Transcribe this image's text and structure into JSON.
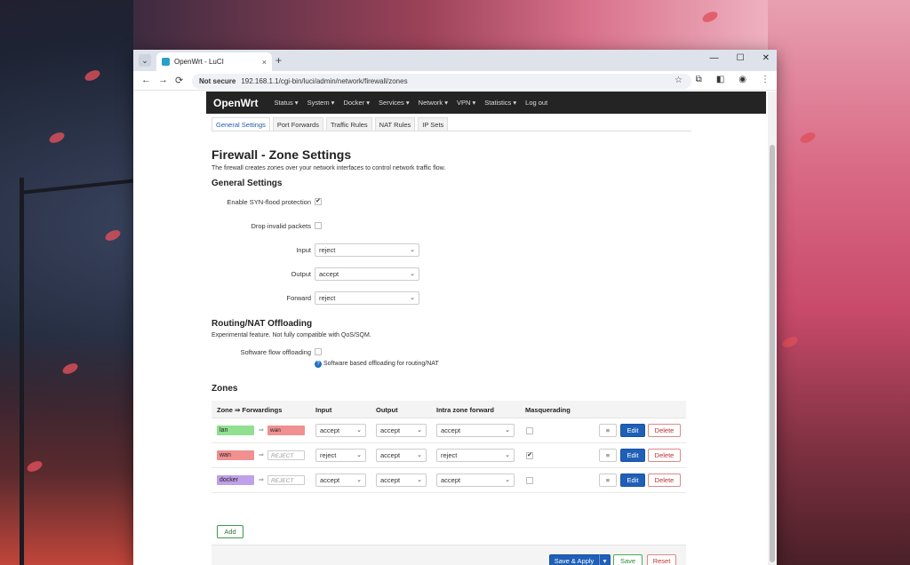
{
  "browser": {
    "tab_title": "OpenWrt - LuCI",
    "tab_close": "×",
    "new_tab": "+",
    "tab_dropdown": "⌄",
    "not_secure": "Not secure",
    "url": "192.168.1.1/cgi-bin/luci/admin/network/firewall/zones",
    "minimize": "—",
    "maximize": "☐",
    "close": "✕",
    "back": "←",
    "forward": "→",
    "reload": "⟳",
    "star": "☆",
    "ext": "⧉",
    "sidepanel": "◧",
    "profile": "◉",
    "menu": "⋮"
  },
  "nav": {
    "brand": "OpenWrt",
    "items": [
      "Status ▾",
      "System ▾",
      "Docker ▾",
      "Services ▾",
      "Network ▾",
      "VPN ▾",
      "Statistics ▾",
      "Log out"
    ]
  },
  "subtabs": [
    "General Settings",
    "Port Forwards",
    "Traffic Rules",
    "NAT Rules",
    "IP Sets"
  ],
  "page": {
    "title": "Firewall - Zone Settings",
    "description": "The firewall creates zones over your network interfaces to control network traffic flow."
  },
  "general": {
    "heading": "General Settings",
    "syn_label": "Enable SYN-flood protection",
    "syn_checked": "✔",
    "drop_label": "Drop invalid packets",
    "input_label": "Input",
    "input_value": "reject",
    "output_label": "Output",
    "output_value": "accept",
    "forward_label": "Forward",
    "forward_value": "reject"
  },
  "offload": {
    "heading": "Routing/NAT Offloading",
    "description": "Experimental feature. Not fully compatible with QoS/SQM.",
    "flow_label": "Software flow offloading",
    "hint": "Software based offloading for routing/NAT"
  },
  "zones": {
    "heading": "Zones",
    "headers": [
      "Zone ⇒ Forwardings",
      "Input",
      "Output",
      "Intra zone forward",
      "Masquerading"
    ],
    "rows": [
      {
        "zone": "lan",
        "zone_color": "#90e090",
        "fwd": "wan",
        "fwd_color": "#f09090",
        "fwd_reject": false,
        "input": "accept",
        "output": "accept",
        "intra": "accept",
        "masq": ""
      },
      {
        "zone": "wan",
        "zone_color": "#f09090",
        "fwd": "REJECT",
        "fwd_color": "#ffffff",
        "fwd_reject": true,
        "input": "reject",
        "output": "accept",
        "intra": "reject",
        "masq": "✔"
      },
      {
        "zone": "docker",
        "zone_color": "#c0a0e8",
        "fwd": "REJECT",
        "fwd_color": "#ffffff",
        "fwd_reject": true,
        "input": "accept",
        "output": "accept",
        "intra": "accept",
        "masq": ""
      }
    ],
    "drag": "≡",
    "edit": "Edit",
    "delete": "Delete",
    "add": "Add"
  },
  "footer": {
    "save_apply": "Save & Apply",
    "save_apply_dd": "▾",
    "save": "Save",
    "reset": "Reset"
  }
}
